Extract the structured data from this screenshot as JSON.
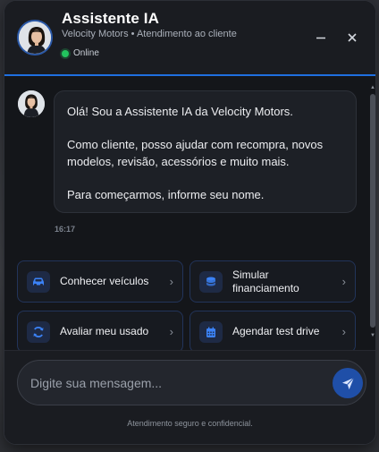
{
  "header": {
    "title": "Assistente IA",
    "subtitle": "Velocity Motors • Atendimento ao cliente",
    "status": "Online",
    "status_color": "#22c55e",
    "minimize_icon": "minus-icon",
    "close_icon": "close-icon",
    "accent_color": "#1f6fe0"
  },
  "messages": [
    {
      "sender": "assistant",
      "paragraphs": [
        "Olá! Sou a Assistente IA da Velocity Motors.",
        "Como cliente, posso ajudar com recompra, novos modelos, revisão, acessórios e muito mais.",
        "Para começarmos, informe seu nome."
      ],
      "time": "16:17"
    }
  ],
  "quick_actions": [
    {
      "label": "Conhecer veículos",
      "icon": "car-icon"
    },
    {
      "label": "Simular financiamento",
      "icon": "coins-icon"
    },
    {
      "label": "Avaliar meu usado",
      "icon": "refresh-icon"
    },
    {
      "label": "Agendar test drive",
      "icon": "calendar-icon"
    }
  ],
  "composer": {
    "placeholder": "Digite sua mensagem...",
    "value": "",
    "send_icon": "send-icon"
  },
  "footer_note": "Atendimento seguro e confidencial."
}
